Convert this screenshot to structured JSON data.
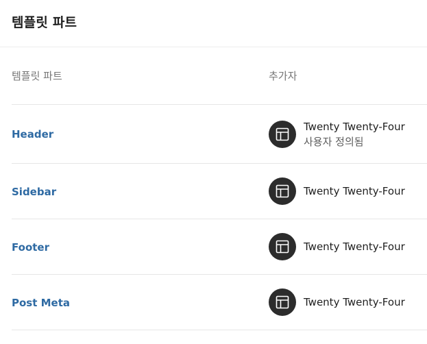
{
  "page": {
    "title": "템플릿 파트"
  },
  "table": {
    "columns": {
      "name": "템플릿 파트",
      "author": "추가자"
    },
    "rows": [
      {
        "name": "Header",
        "author": "Twenty Twenty-Four",
        "status": "사용자 정의됨",
        "icon": "layout-icon"
      },
      {
        "name": "Sidebar",
        "author": "Twenty Twenty-Four",
        "status": "",
        "icon": "layout-icon"
      },
      {
        "name": "Footer",
        "author": "Twenty Twenty-Four",
        "status": "",
        "icon": "layout-icon"
      },
      {
        "name": "Post Meta",
        "author": "Twenty Twenty-Four",
        "status": "",
        "icon": "layout-icon"
      }
    ]
  },
  "colors": {
    "link": "#2e6aa3",
    "avatar_bg": "#2c2c2c",
    "muted_text": "#757575"
  }
}
